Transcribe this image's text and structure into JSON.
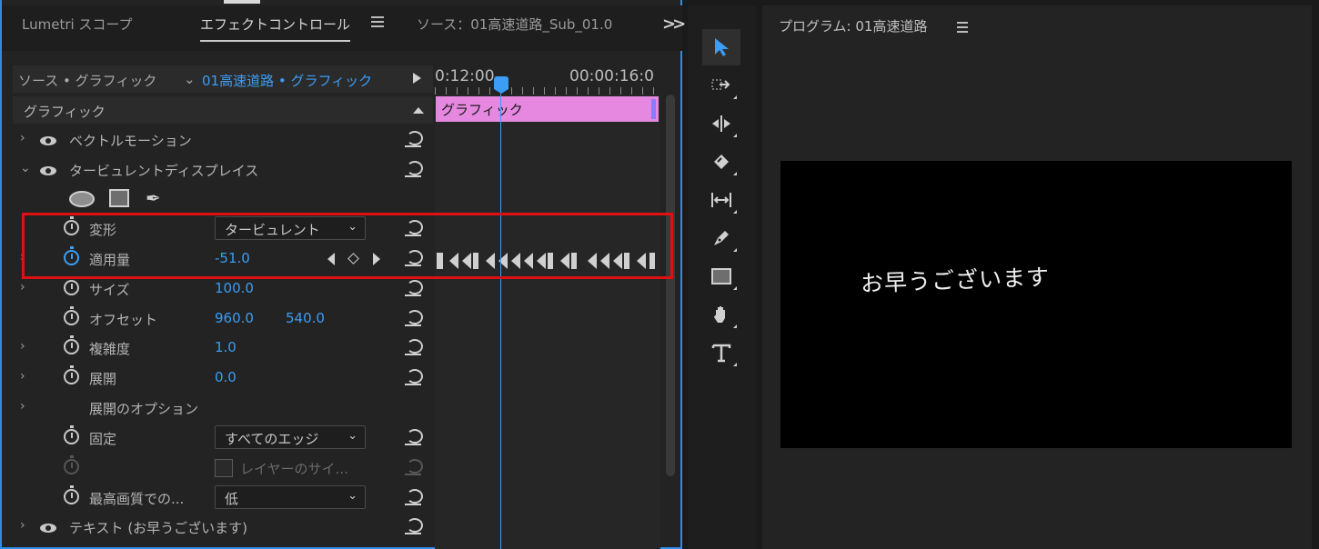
{
  "effect_controls": {
    "tabs": [
      "Lumetri スコープ",
      "エフェクトコントロール",
      "ソース：01高速道路_Sub_01.0"
    ],
    "source_label": "ソース • グラフィック",
    "sequence_label": "01高速道路 • グラフィック",
    "ruler": {
      "tc_left": "0:12:00",
      "tc_right": "00:00:16:0"
    },
    "section_title": "グラフィック",
    "clip_label": "グラフィック",
    "effects": [
      {
        "name": "ベクトルモーション"
      },
      {
        "name": "タービュレントディスプレイス"
      }
    ],
    "properties": {
      "displacement": {
        "label": "変形",
        "value": "タービュレント"
      },
      "amount": {
        "label": "適用量",
        "value": "-51.0"
      },
      "size": {
        "label": "サイズ",
        "value": "100.0"
      },
      "offset": {
        "label": "オフセット",
        "x": "960.0",
        "y": "540.0"
      },
      "complexity": {
        "label": "複雑度",
        "value": "1.0"
      },
      "evolution": {
        "label": "展開",
        "value": "0.0"
      },
      "evolution_options": {
        "label": "展開のオプション"
      },
      "pinning": {
        "label": "固定",
        "value": "すべてのエッジ"
      },
      "layer_size": {
        "label": "レイヤーのサイ..."
      },
      "quality": {
        "label": "最高画質での...",
        "value": "低"
      }
    },
    "text_layer": {
      "name": "テキスト (お早うございます)"
    },
    "accent_color": "#3b9df5",
    "clip_color": "#e688e0",
    "highlight_color": "#e01010"
  },
  "tools": [
    "selection-tool",
    "track-select-tool",
    "ripple-edit-tool",
    "razor-tool",
    "slip-tool",
    "pen-tool",
    "rectangle-tool",
    "hand-tool",
    "type-tool"
  ],
  "program_monitor": {
    "title": "プログラム: 01高速道路",
    "overlay_text": "お早うございます"
  }
}
